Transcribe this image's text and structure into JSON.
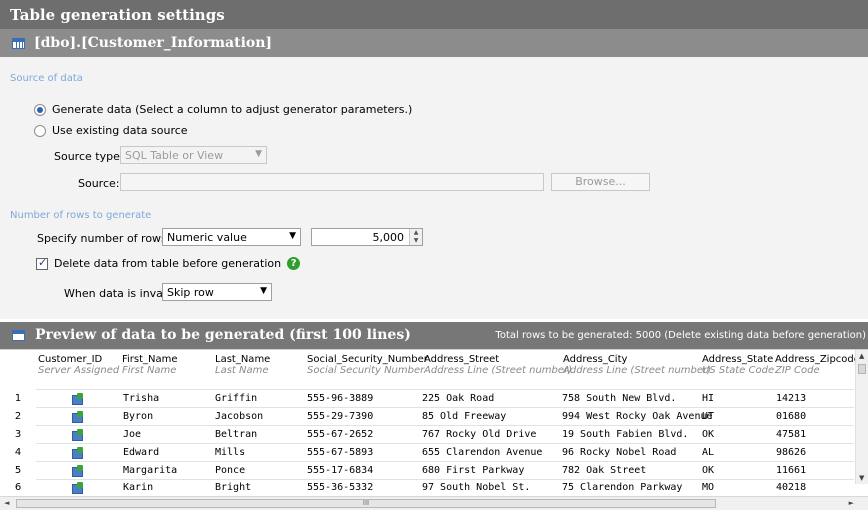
{
  "window": {
    "title": "Table generation settings"
  },
  "table": {
    "name": "[dbo].[Customer_Information]"
  },
  "source": {
    "section_label": "Source of data",
    "generate_label": "Generate data (Select a column to adjust generator parameters.)",
    "existing_label": "Use existing data source",
    "generate_selected": true,
    "source_type_label": "Source type:",
    "source_type_value": "SQL Table or View",
    "source_label": "Source:",
    "source_value": "",
    "browse_label": "Browse..."
  },
  "rows": {
    "section_label": "Number of rows to generate",
    "specify_label": "Specify number of rows by:",
    "specify_value": "Numeric value",
    "count_value": "5,000",
    "delete_label": "Delete data from table before generation",
    "delete_checked": true,
    "invalid_label": "When data is invalid:",
    "invalid_value": "Skip row"
  },
  "preview": {
    "title": "Preview of data to be generated (first 100 lines)",
    "note": "Total rows to be generated: 5000 (Delete existing data before generation)",
    "columns": [
      {
        "name": "Customer_ID",
        "sub": "Server Assigned"
      },
      {
        "name": "First_Name",
        "sub": "First Name"
      },
      {
        "name": "Last_Name",
        "sub": "Last Name"
      },
      {
        "name": "Social_Security_Number",
        "sub": "Social Security Number"
      },
      {
        "name": "Address_Street",
        "sub": "Address Line (Street number)"
      },
      {
        "name": "Address_City",
        "sub": "Address Line (Street number)"
      },
      {
        "name": "Address_State",
        "sub": "US State Code"
      },
      {
        "name": "Address_Zipcode",
        "sub": "ZIP Code"
      }
    ],
    "rows": [
      {
        "num": "1",
        "first": "Trisha",
        "last": "Griffin",
        "ssn": "555-96-3889",
        "street": "225 Oak Road",
        "city": "758 South New Blvd.",
        "state": "HI",
        "zip": "14213"
      },
      {
        "num": "2",
        "first": "Byron",
        "last": "Jacobson",
        "ssn": "555-29-7390",
        "street": "85 Old Freeway",
        "city": "994 West Rocky Oak Avenue",
        "state": "UT",
        "zip": "01680"
      },
      {
        "num": "3",
        "first": "Joe",
        "last": "Beltran",
        "ssn": "555-67-2652",
        "street": "767 Rocky Old Drive",
        "city": "19 South Fabien Blvd.",
        "state": "OK",
        "zip": "47581"
      },
      {
        "num": "4",
        "first": "Edward",
        "last": "Mills",
        "ssn": "555-67-5893",
        "street": "655 Clarendon Avenue",
        "city": "96 Rocky Nobel Road",
        "state": "AL",
        "zip": "98626"
      },
      {
        "num": "5",
        "first": "Margarita",
        "last": "Ponce",
        "ssn": "555-17-6834",
        "street": "680 First Parkway",
        "city": "782 Oak Street",
        "state": "OK",
        "zip": "11661"
      },
      {
        "num": "6",
        "first": "Karin",
        "last": "Bright",
        "ssn": "555-36-5332",
        "street": "97 South Nobel St.",
        "city": "75 Clarendon Parkway",
        "state": "MO",
        "zip": "40218"
      }
    ]
  },
  "scrollbar": {
    "h_thumb_label": "III"
  }
}
